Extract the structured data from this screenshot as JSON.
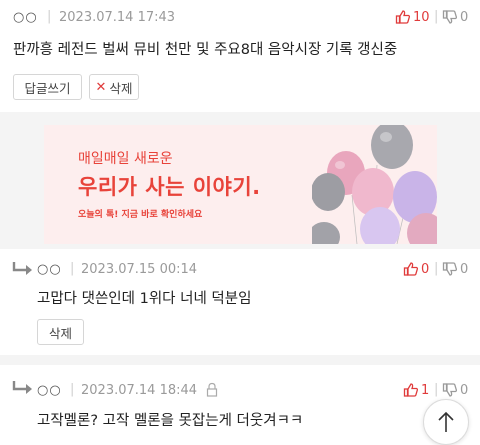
{
  "comment1": {
    "nickname": "○○",
    "date": "2023.07.14 17:43",
    "up": "10",
    "down": "0",
    "text": "판까흥 레전드 벌써 뮤비 천만 및 주요8대 음악시장 기록 갱신중",
    "reply_label": "답글쓰기",
    "delete_label": "삭제"
  },
  "ad": {
    "line1": "매일매일 새로운",
    "line2": "우리가 사는 이야기.",
    "line3": "오늘의 톡! 지금 바로 확인하세요"
  },
  "reply1": {
    "nickname": "○○",
    "date": "2023.07.15 00:14",
    "up": "0",
    "down": "0",
    "text": "고맙다 댓쓴인데 1위다 너네 덕분임",
    "delete_label": "삭제"
  },
  "reply2": {
    "nickname": "○○",
    "date": "2023.07.14 18:44",
    "up": "1",
    "down": "0",
    "text": "고작멜론? 고작 멜론을 못잡는게 더웃겨ㅋㅋ"
  },
  "colors": {
    "upvote": "#e03b3b",
    "muted": "#9a9a9a",
    "ad_red": "#e8433a"
  }
}
